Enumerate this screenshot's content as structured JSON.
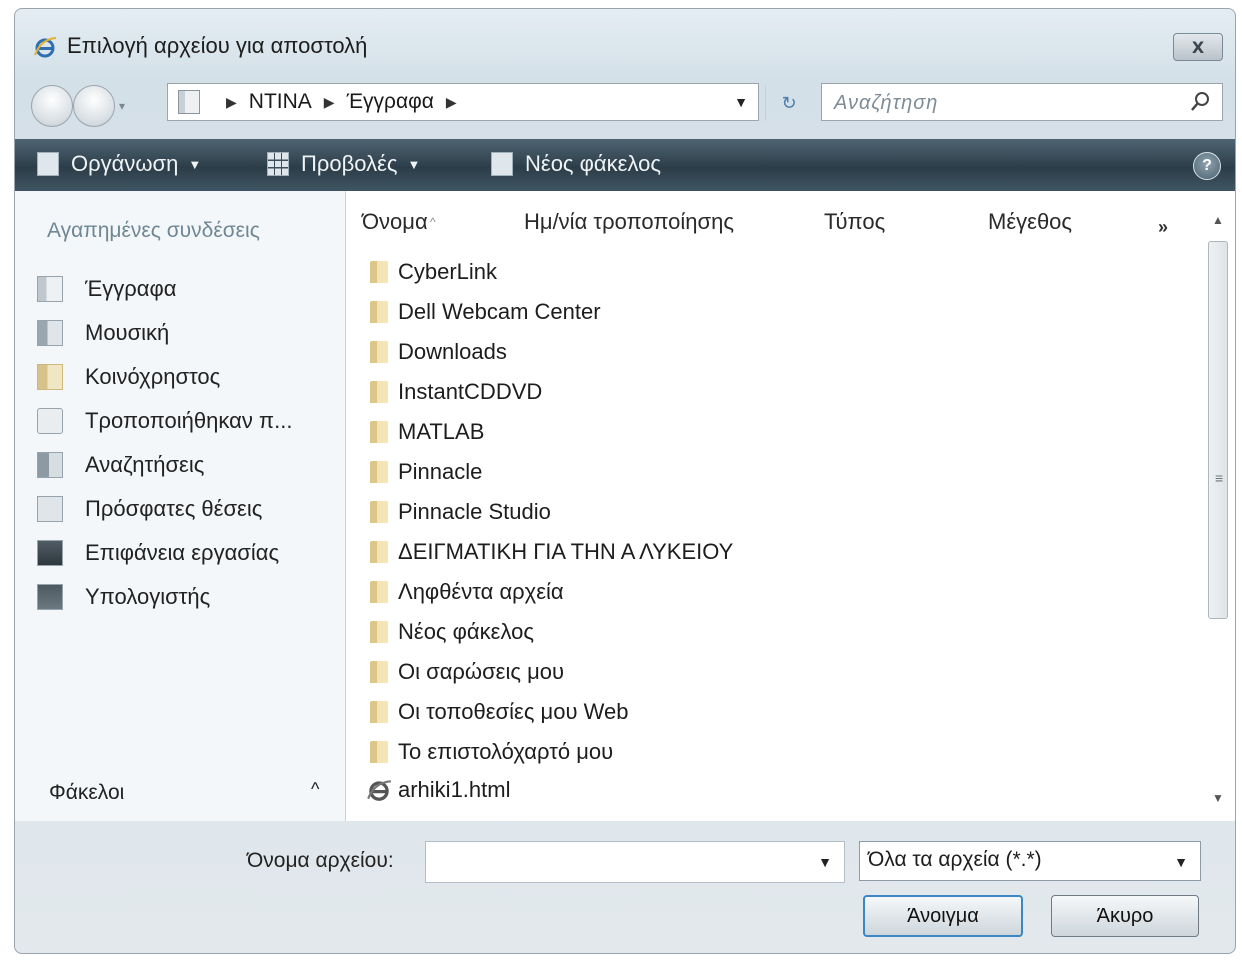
{
  "window": {
    "title": "Επιλογή αρχείου για αποστολή",
    "close_label": "X"
  },
  "address": {
    "segments": [
      "NTINA",
      "Έγγραφα"
    ],
    "search_placeholder": "Αναζήτηση"
  },
  "toolbar": {
    "organize": "Οργάνωση",
    "views": "Προβολές",
    "new_folder": "Νέος φάκελος",
    "help": "?"
  },
  "sidebar": {
    "heading": "Αγαπημένες συνδέσεις",
    "items": [
      {
        "label": "Έγγραφα",
        "icon": "documents-icon"
      },
      {
        "label": "Μουσική",
        "icon": "music-icon"
      },
      {
        "label": "Κοινόχρηστος",
        "icon": "shared-folder-icon"
      },
      {
        "label": "Τροποποιήθηκαν π...",
        "icon": "recently-changed-icon"
      },
      {
        "label": "Αναζητήσεις",
        "icon": "searches-icon"
      },
      {
        "label": "Πρόσφατες θέσεις",
        "icon": "recent-places-icon"
      },
      {
        "label": "Επιφάνεια εργασίας",
        "icon": "desktop-icon"
      },
      {
        "label": "Υπολογιστής",
        "icon": "computer-icon"
      }
    ],
    "folders_label": "Φάκελοι",
    "folders_chevron": "^"
  },
  "file_list": {
    "columns": [
      "Όνομα",
      "Ημ/νία τροποποίησης",
      "Τύπος",
      "Μέγεθος"
    ],
    "more_columns": "»",
    "items": [
      {
        "name": "CyberLink",
        "icon": "folder-icon"
      },
      {
        "name": "Dell Webcam Center",
        "icon": "folder-icon"
      },
      {
        "name": "Downloads",
        "icon": "folder-icon"
      },
      {
        "name": "InstantCDDVD",
        "icon": "folder-icon"
      },
      {
        "name": "MATLAB",
        "icon": "folder-icon"
      },
      {
        "name": "Pinnacle",
        "icon": "folder-icon"
      },
      {
        "name": "Pinnacle Studio",
        "icon": "folder-icon"
      },
      {
        "name": "ΔΕΙΓΜΑΤΙΚΗ ΓΙΑ ΤΗΝ Α ΛΥΚΕΙΟΥ",
        "icon": "folder-icon"
      },
      {
        "name": "Ληφθέντα αρχεία",
        "icon": "folder-icon"
      },
      {
        "name": "Νέος φάκελος",
        "icon": "folder-icon"
      },
      {
        "name": "Οι σαρώσεις μου",
        "icon": "folder-icon"
      },
      {
        "name": "Οι τοποθεσίες μου Web",
        "icon": "folder-icon"
      },
      {
        "name": "Το επιστολόχαρτό μου",
        "icon": "folder-icon"
      },
      {
        "name": "arhiki1.html",
        "icon": "ie-html-icon"
      }
    ]
  },
  "footer": {
    "filename_label": "Όνομα αρχείου:",
    "filename_value": "",
    "filter_value": "Όλα τα αρχεία (*.*)",
    "open_label": "Άνοιγμα",
    "cancel_label": "Άκυρο"
  }
}
